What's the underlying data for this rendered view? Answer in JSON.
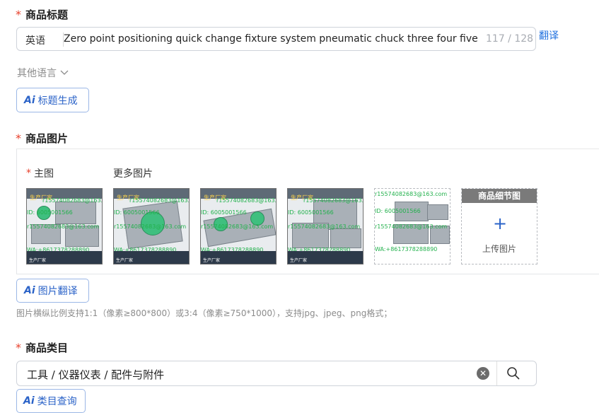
{
  "title_section": {
    "required_mark": "*",
    "label": "商品标题",
    "lang_tag": "英语",
    "value": "Zero point positioning quick change fixture system pneumatic chuck three four five axis",
    "count": "117 / 128",
    "translate_link": "翻译",
    "other_lang": "其他语言",
    "ai_button_mark": "Ai",
    "ai_button_label": "标题生成"
  },
  "image_section": {
    "required_mark": "*",
    "label": "商品图片",
    "main_required": "*",
    "main_label": "主图",
    "more_label": "更多图片",
    "thumb_watermarks": {
      "email": "r15574082683@163.com",
      "id": "ID: 6005001566",
      "whatsapp": "WA:+8617378288890",
      "factory": "生产厂家"
    },
    "detail_header": "商品细节图",
    "upload_icon": "+",
    "upload_label": "上传图片",
    "ai_button_mark": "Ai",
    "ai_button_label": "图片翻译",
    "hint": "图片横纵比例支持1:1（像素≥800*800）或3:4（像素≥750*1000），支持jpg、jpeg、png格式；"
  },
  "category_section": {
    "required_mark": "*",
    "label": "商品类目",
    "value": "工具 / 仪器仪表 / 配件与附件",
    "ai_button_mark": "Ai",
    "ai_button_label": "类目查询"
  },
  "colors": {
    "accent": "#2b63c8",
    "required": "#e8412c",
    "watermark": "#22b14c"
  }
}
